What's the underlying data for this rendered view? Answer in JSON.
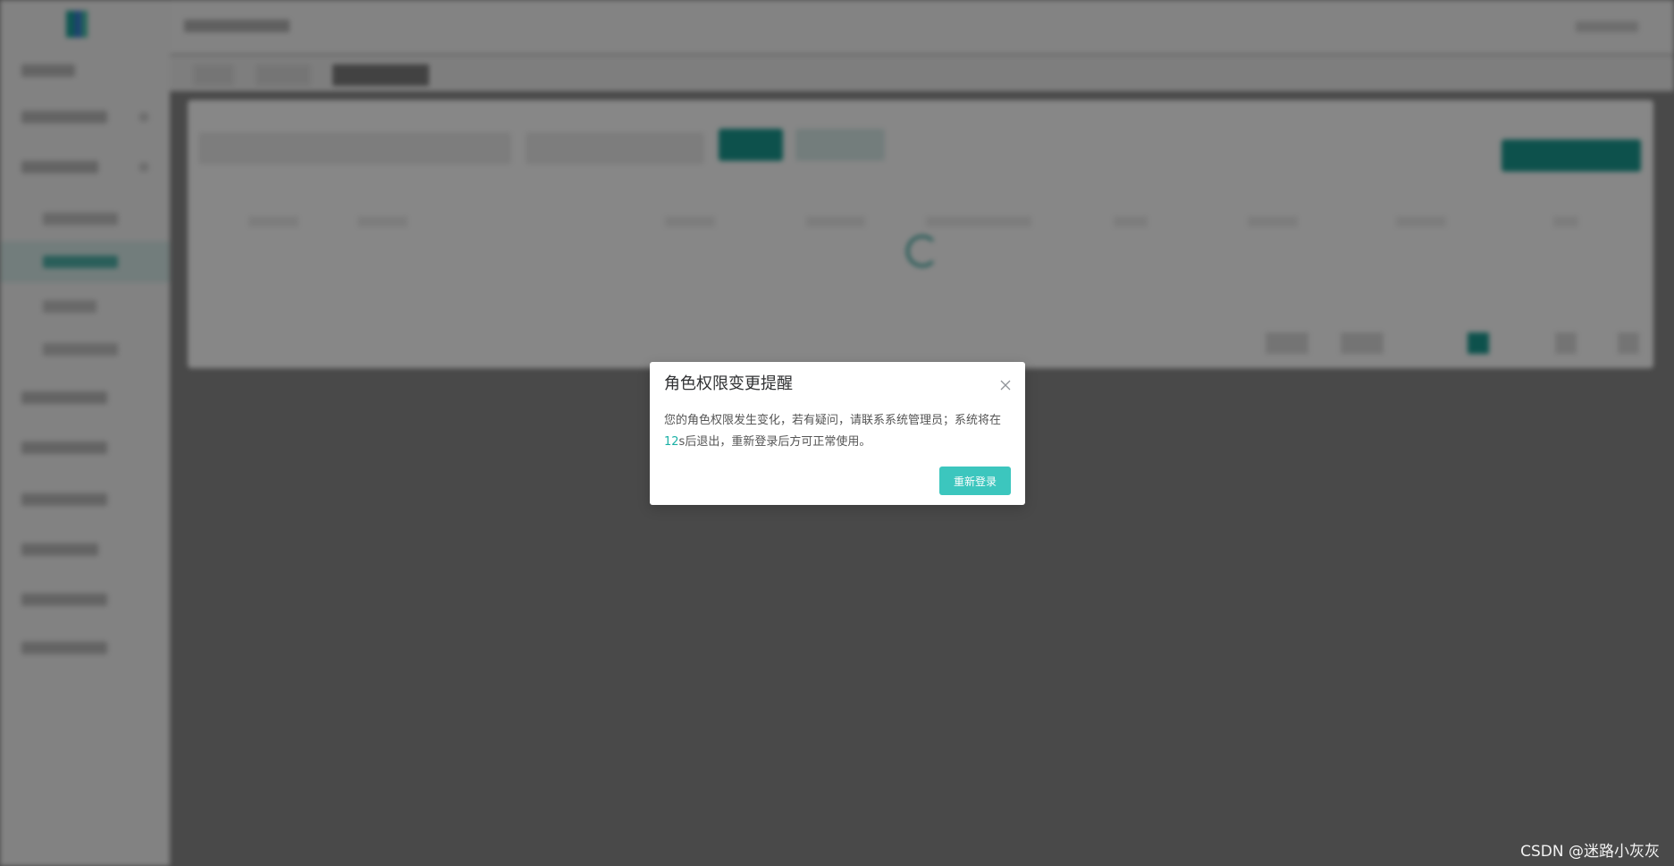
{
  "dialog": {
    "title": "角色权限变更提醒",
    "message_before": "您的角色权限发生变化，若有疑问，请联系系统管理员；系统将在",
    "countdown_value": "12",
    "message_unit": "s",
    "message_after": "后退出，重新登录后方可正常使用。",
    "relogin_button": "重新登录"
  },
  "colors": {
    "accent": "#3cc6be",
    "countdown_text": "#1ab0a6",
    "overlay": "rgba(0,0,0,0.47)"
  },
  "icons": {
    "close": "close-icon"
  },
  "watermark": "CSDN @迷路小灰灰"
}
